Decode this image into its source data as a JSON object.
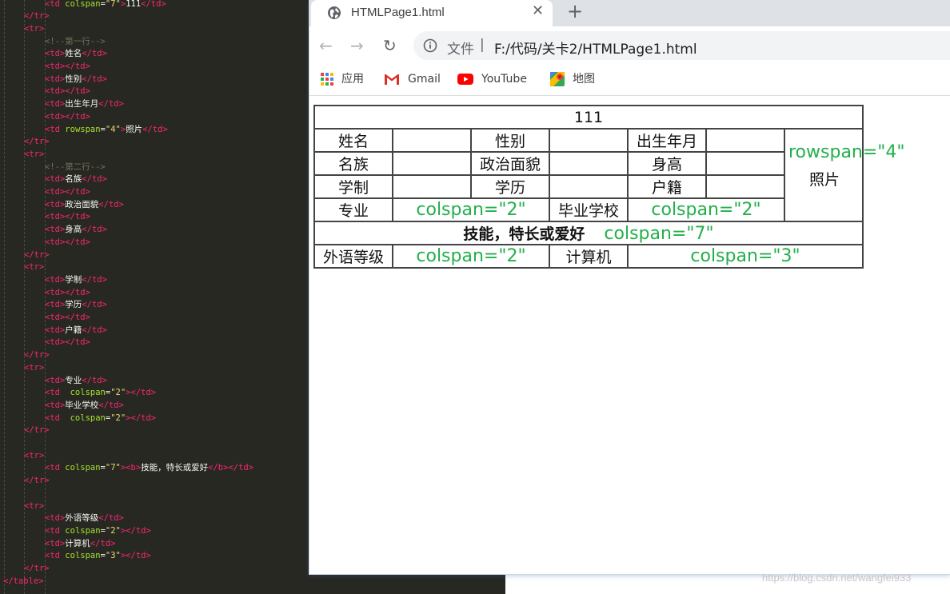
{
  "editor": {
    "lines": [
      {
        "indent": 2,
        "parts": [
          [
            "tag",
            "<td "
          ],
          [
            "attr",
            "colspan"
          ],
          [
            "punc",
            "="
          ],
          [
            "str",
            "\"7\""
          ],
          [
            "tag",
            ">"
          ],
          [
            "txt",
            "111"
          ],
          [
            "tag",
            "</td>"
          ]
        ]
      },
      {
        "indent": 1,
        "parts": [
          [
            "tag",
            "</tr>"
          ]
        ]
      },
      {
        "indent": 1,
        "parts": [
          [
            "tag",
            "<tr>"
          ]
        ]
      },
      {
        "indent": 2,
        "parts": [
          [
            "cmt",
            "<!--第一行-->"
          ]
        ]
      },
      {
        "indent": 2,
        "parts": [
          [
            "tag",
            "<td>"
          ],
          [
            "txt",
            "姓名"
          ],
          [
            "tag",
            "</td>"
          ]
        ]
      },
      {
        "indent": 2,
        "parts": [
          [
            "tag",
            "<td></td>"
          ]
        ]
      },
      {
        "indent": 2,
        "parts": [
          [
            "tag",
            "<td>"
          ],
          [
            "txt",
            "性别"
          ],
          [
            "tag",
            "</td>"
          ]
        ]
      },
      {
        "indent": 2,
        "parts": [
          [
            "tag",
            "<td></td>"
          ]
        ]
      },
      {
        "indent": 2,
        "parts": [
          [
            "tag",
            "<td>"
          ],
          [
            "txt",
            "出生年月"
          ],
          [
            "tag",
            "</td>"
          ]
        ]
      },
      {
        "indent": 2,
        "parts": [
          [
            "tag",
            "<td></td>"
          ]
        ]
      },
      {
        "indent": 2,
        "parts": [
          [
            "tag",
            "<td "
          ],
          [
            "attr",
            "rowspan"
          ],
          [
            "punc",
            "="
          ],
          [
            "str",
            "\"4\""
          ],
          [
            "tag",
            ">"
          ],
          [
            "txt",
            "照片"
          ],
          [
            "tag",
            "</td>"
          ]
        ]
      },
      {
        "indent": 1,
        "parts": [
          [
            "tag",
            "</tr>"
          ]
        ]
      },
      {
        "indent": 1,
        "parts": [
          [
            "tag",
            "<tr>"
          ]
        ]
      },
      {
        "indent": 2,
        "parts": [
          [
            "cmt",
            "<!--第二行-->"
          ]
        ]
      },
      {
        "indent": 2,
        "parts": [
          [
            "tag",
            "<td>"
          ],
          [
            "txt",
            "名族"
          ],
          [
            "tag",
            "</td>"
          ]
        ]
      },
      {
        "indent": 2,
        "parts": [
          [
            "tag",
            "<td></td>"
          ]
        ]
      },
      {
        "indent": 2,
        "parts": [
          [
            "tag",
            "<td>"
          ],
          [
            "txt",
            "政治面貌"
          ],
          [
            "tag",
            "</td>"
          ]
        ]
      },
      {
        "indent": 2,
        "parts": [
          [
            "tag",
            "<td></td>"
          ]
        ]
      },
      {
        "indent": 2,
        "parts": [
          [
            "tag",
            "<td>"
          ],
          [
            "txt",
            "身高"
          ],
          [
            "tag",
            "</td>"
          ]
        ]
      },
      {
        "indent": 2,
        "parts": [
          [
            "tag",
            "<td></td>"
          ]
        ]
      },
      {
        "indent": 1,
        "parts": [
          [
            "tag",
            "</tr>"
          ]
        ]
      },
      {
        "indent": 1,
        "parts": [
          [
            "tag",
            "<tr>"
          ]
        ]
      },
      {
        "indent": 2,
        "parts": [
          [
            "tag",
            "<td>"
          ],
          [
            "txt",
            "学制"
          ],
          [
            "tag",
            "</td>"
          ]
        ]
      },
      {
        "indent": 2,
        "parts": [
          [
            "tag",
            "<td></td>"
          ]
        ]
      },
      {
        "indent": 2,
        "parts": [
          [
            "tag",
            "<td>"
          ],
          [
            "txt",
            "学历"
          ],
          [
            "tag",
            "</td>"
          ]
        ]
      },
      {
        "indent": 2,
        "parts": [
          [
            "tag",
            "<td></td>"
          ]
        ]
      },
      {
        "indent": 2,
        "parts": [
          [
            "tag",
            "<td>"
          ],
          [
            "txt",
            "户籍"
          ],
          [
            "tag",
            "</td>"
          ]
        ]
      },
      {
        "indent": 2,
        "parts": [
          [
            "tag",
            "<td></td>"
          ]
        ]
      },
      {
        "indent": 1,
        "parts": [
          [
            "tag",
            "</tr>"
          ]
        ]
      },
      {
        "indent": 1,
        "parts": [
          [
            "tag",
            "<tr>"
          ]
        ]
      },
      {
        "indent": 2,
        "parts": [
          [
            "tag",
            "<td>"
          ],
          [
            "txt",
            "专业"
          ],
          [
            "tag",
            "</td>"
          ]
        ]
      },
      {
        "indent": 2,
        "parts": [
          [
            "tag",
            "<td  "
          ],
          [
            "attr",
            "colspan"
          ],
          [
            "punc",
            "="
          ],
          [
            "str",
            "\"2\""
          ],
          [
            "tag",
            "></td>"
          ]
        ]
      },
      {
        "indent": 2,
        "parts": [
          [
            "tag",
            "<td>"
          ],
          [
            "txt",
            "毕业学校"
          ],
          [
            "tag",
            "</td>"
          ]
        ]
      },
      {
        "indent": 2,
        "parts": [
          [
            "tag",
            "<td  "
          ],
          [
            "attr",
            "colspan"
          ],
          [
            "punc",
            "="
          ],
          [
            "str",
            "\"2\""
          ],
          [
            "tag",
            "></td>"
          ]
        ]
      },
      {
        "indent": 1,
        "parts": [
          [
            "tag",
            "</tr>"
          ]
        ]
      },
      {
        "indent": 0,
        "parts": []
      },
      {
        "indent": 1,
        "parts": [
          [
            "tag",
            "<tr>"
          ]
        ]
      },
      {
        "indent": 2,
        "parts": [
          [
            "tag",
            "<td "
          ],
          [
            "attr",
            "colspan"
          ],
          [
            "punc",
            "="
          ],
          [
            "str",
            "\"7\""
          ],
          [
            "tag",
            "><b>"
          ],
          [
            "txt",
            "技能，特长或爱好"
          ],
          [
            "tag",
            "</b></td>"
          ]
        ]
      },
      {
        "indent": 1,
        "parts": [
          [
            "tag",
            "</tr>"
          ]
        ]
      },
      {
        "indent": 0,
        "parts": []
      },
      {
        "indent": 1,
        "parts": [
          [
            "tag",
            "<tr>"
          ]
        ]
      },
      {
        "indent": 2,
        "parts": [
          [
            "tag",
            "<td>"
          ],
          [
            "txt",
            "外语等级"
          ],
          [
            "tag",
            "</td>"
          ]
        ]
      },
      {
        "indent": 2,
        "parts": [
          [
            "tag",
            "<td "
          ],
          [
            "attr",
            "colspan"
          ],
          [
            "punc",
            "="
          ],
          [
            "str",
            "\"2\""
          ],
          [
            "tag",
            "></td>"
          ]
        ]
      },
      {
        "indent": 2,
        "parts": [
          [
            "tag",
            "<td>"
          ],
          [
            "txt",
            "计算机"
          ],
          [
            "tag",
            "</td>"
          ]
        ]
      },
      {
        "indent": 2,
        "parts": [
          [
            "tag",
            "<td "
          ],
          [
            "attr",
            "colspan"
          ],
          [
            "punc",
            "="
          ],
          [
            "str",
            "\"3\""
          ],
          [
            "tag",
            "></td>"
          ]
        ]
      },
      {
        "indent": 1,
        "parts": [
          [
            "tag",
            "</tr>"
          ]
        ]
      },
      {
        "indent": 0,
        "parts": [
          [
            "tag",
            "</table>"
          ]
        ]
      }
    ]
  },
  "browser": {
    "tab_title": "HTMLPage1.html",
    "tab_close": "✕",
    "new_tab": "+",
    "back": "←",
    "forward": "→",
    "reload": "↻",
    "url_label": "文件",
    "url_sep": "|",
    "url": "F:/代码/关卡2/HTMLPage1.html",
    "bookmarks": [
      {
        "name": "apps",
        "label": "应用"
      },
      {
        "name": "gmail",
        "label": "Gmail"
      },
      {
        "name": "youtube",
        "label": "YouTube"
      },
      {
        "name": "maps",
        "label": "地图"
      }
    ]
  },
  "table": {
    "header": "111",
    "row1": [
      "姓名",
      "性别",
      "出生年月"
    ],
    "photo_note": "rowspan=\"4\"",
    "photo": "照片",
    "row2": [
      "名族",
      "政治面貌",
      "身高"
    ],
    "row3": [
      "学制",
      "学历",
      "户籍"
    ],
    "row4": {
      "major": "专业",
      "span_a": "colspan=\"2\"",
      "school": "毕业学校",
      "span_b": "colspan=\"2\""
    },
    "row5": {
      "skills": "技能，特长或爱好",
      "span": "colspan=\"7\""
    },
    "row6": {
      "lang": "外语等级",
      "span_a": "colspan=\"2\"",
      "computer": "计算机",
      "span_b": "colspan=\"3\""
    }
  },
  "watermark": "https://blog.csdn.net/wangfei933",
  "colors": {
    "annotation": "#22b04b",
    "editor_bg": "#272822"
  }
}
